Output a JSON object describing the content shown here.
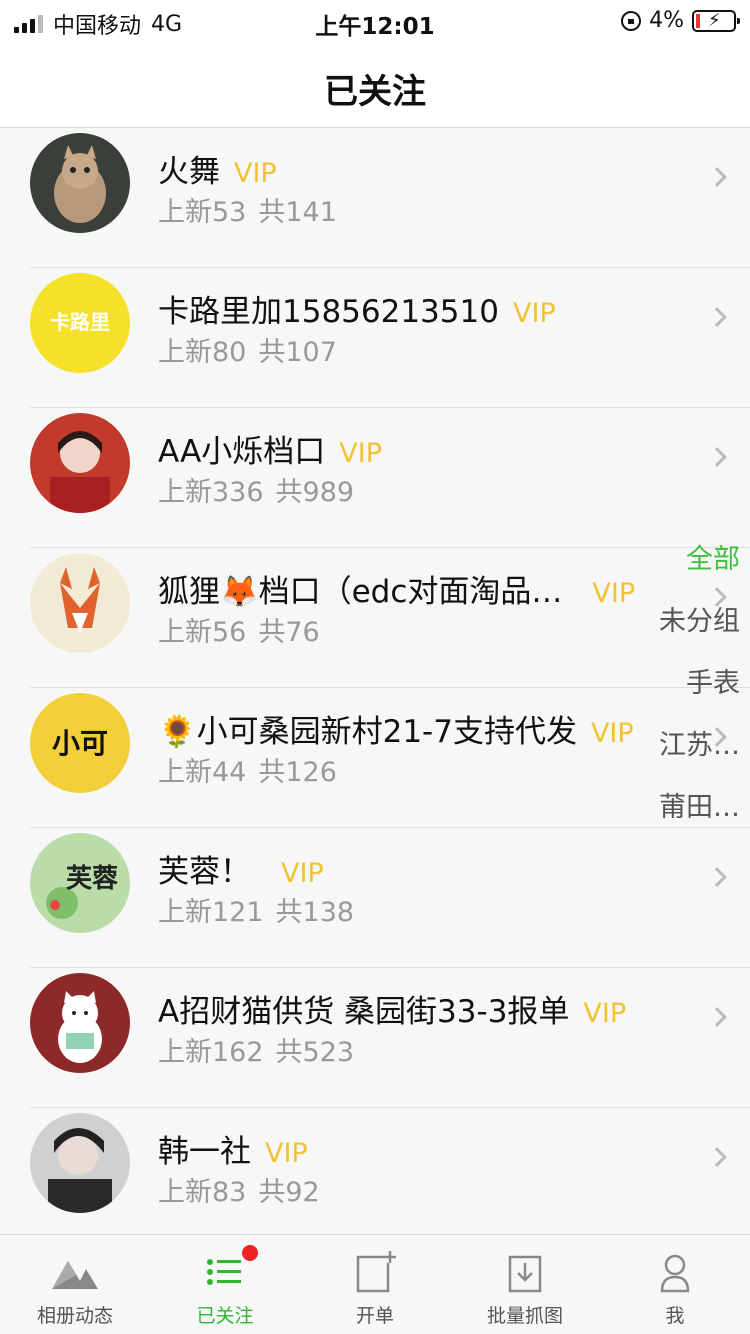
{
  "status_bar": {
    "carrier": "中国移动",
    "network": "4G",
    "time": "上午12:01",
    "battery": "4%"
  },
  "nav": {
    "title": "已关注"
  },
  "stores": [
    {
      "name": "火舞",
      "vip": "VIP",
      "new": "上新53",
      "total": "共141",
      "avatar_color": "#6d5a4a"
    },
    {
      "name": "卡路里加15856213510",
      "vip": "VIP",
      "new": "上新80",
      "total": "共107",
      "avatar_color": "#f5e02a",
      "avatar_text": "卡路里"
    },
    {
      "name": "AA小烁档口",
      "vip": "VIP",
      "new": "上新336",
      "total": "共989",
      "avatar_color": "#c23a2c"
    },
    {
      "name": "狐狸🦊档口（edc对面淘品…",
      "vip": "VIP",
      "new": "上新56",
      "total": "共76",
      "avatar_color": "#f3ead6"
    },
    {
      "name": "🌻小可桑园新村21-7支持代发",
      "vip": "VIP",
      "new": "上新44",
      "total": "共126",
      "avatar_color": "#f3cf3a",
      "avatar_text": "小可"
    },
    {
      "name": "芙蓉！",
      "vip": "VIP",
      "new": "上新121",
      "total": "共138",
      "avatar_color": "#9fcf8a",
      "avatar_text": "芙蓉"
    },
    {
      "name": "A招财猫供货 桑园街33-3报单",
      "vip": "VIP",
      "new": "上新162",
      "total": "共523",
      "avatar_color": "#8c2a2a"
    },
    {
      "name": "韩一社",
      "vip": "VIP",
      "new": "上新83",
      "total": "共92",
      "avatar_color": "#4a4a4a"
    }
  ],
  "group_index": [
    "全部",
    "未分组",
    "手表",
    "江苏…",
    "莆田…"
  ],
  "tabs": [
    {
      "label": "相册动态",
      "icon": "mountain-icon"
    },
    {
      "label": "已关注",
      "icon": "list-icon"
    },
    {
      "label": "开单",
      "icon": "new-order-icon"
    },
    {
      "label": "批量抓图",
      "icon": "download-icon"
    },
    {
      "label": "我",
      "icon": "user-icon"
    }
  ],
  "colors": {
    "vip": "#f2c232",
    "accent": "#2fb72f",
    "badge": "#ee2222"
  }
}
